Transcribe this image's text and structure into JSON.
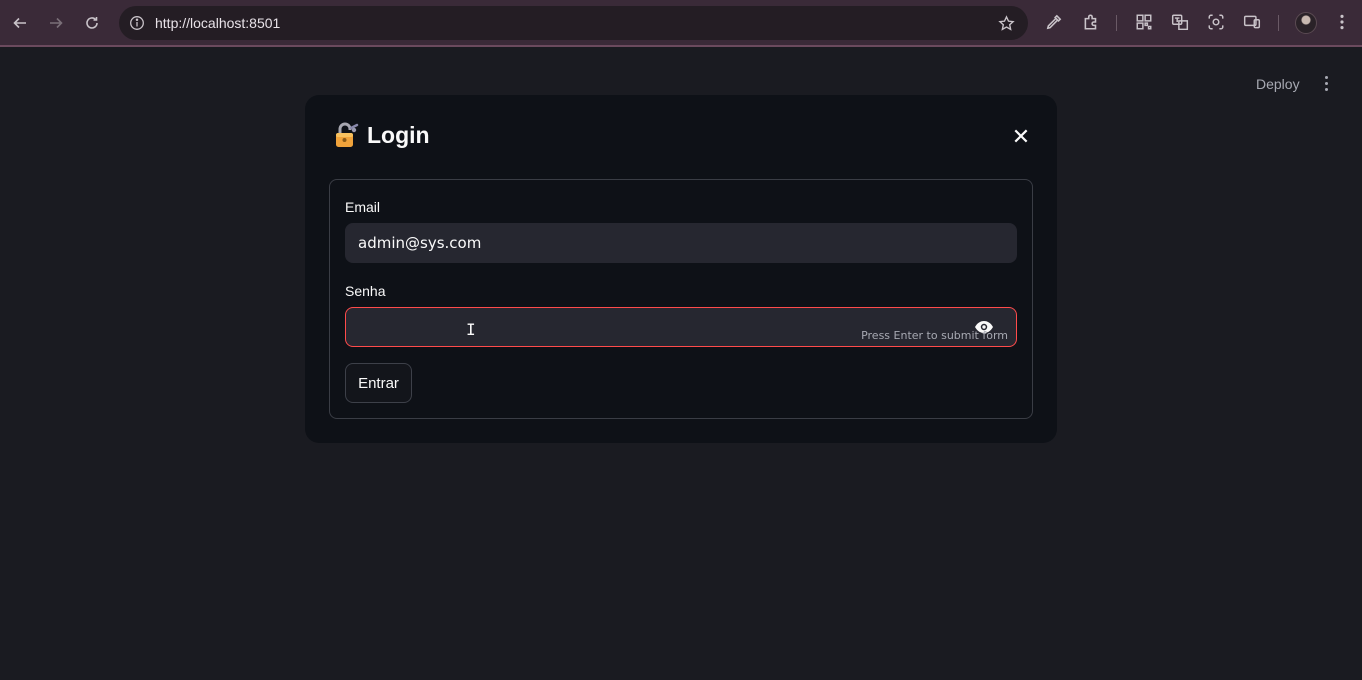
{
  "browser": {
    "url": "http://localhost:8501"
  },
  "app_header": {
    "deploy_label": "Deploy"
  },
  "modal": {
    "title": "Login",
    "close_symbol": "✕",
    "form": {
      "email_label": "Email",
      "email_value": "admin@sys.com",
      "password_label": "Senha",
      "password_value": "",
      "password_hint": "Press Enter to submit form",
      "submit_label": "Entrar"
    }
  },
  "colors": {
    "background": "#1a1b21",
    "modal_bg": "#0e1117",
    "input_bg": "#262730",
    "error_border": "#ff4b4b",
    "chrome_bg": "#3a2a38"
  },
  "icons": {
    "chrome": [
      "back-icon",
      "forward-icon",
      "reload-icon",
      "site-info-icon",
      "bookmark-star-icon",
      "eyedropper-icon",
      "extensions-icon",
      "qr-code-icon",
      "translate-icon",
      "lens-icon",
      "cast-icon",
      "profile-avatar",
      "chrome-menu-icon"
    ],
    "app": [
      "lock-icon",
      "close-icon",
      "eye-icon",
      "kebab-menu-icon"
    ]
  }
}
